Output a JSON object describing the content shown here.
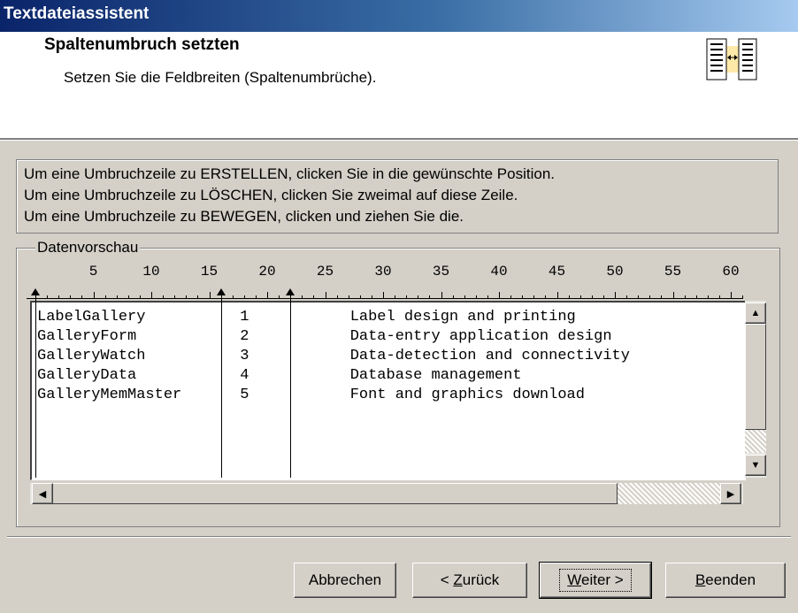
{
  "window": {
    "title": "Textdateiassistent"
  },
  "header": {
    "title": "Spaltenumbruch setzten",
    "subtitle": "Setzen Sie die Feldbreiten (Spaltenumbrüche)."
  },
  "instructions": [
    "Um eine Umbruchzeile zu ERSTELLEN, clicken Sie in die gewünschte Position.",
    "Um eine Umbruchzeile zu LÖSCHEN, clicken Sie zweimal auf diese Zeile.",
    "Um eine Umbruchzeile zu BEWEGEN, clicken und ziehen Sie die."
  ],
  "preview": {
    "label": "Datenvorschau",
    "ruler_numbers": [
      "5",
      "10",
      "15",
      "20",
      "25",
      "30",
      "35",
      "40",
      "45",
      "50",
      "55",
      "60"
    ],
    "column_breaks_at": [
      0,
      16,
      22
    ],
    "rows": [
      [
        "LabelGallery",
        "1",
        "Label design and printing"
      ],
      [
        "GalleryForm",
        "2",
        "Data-entry application design"
      ],
      [
        "GalleryWatch",
        "3",
        "Data-detection and connectivity"
      ],
      [
        "GalleryData",
        "4",
        "Database management"
      ],
      [
        "GalleryMemMaster",
        "5",
        "Font and graphics download"
      ]
    ]
  },
  "buttons": {
    "cancel": "Abbrechen",
    "back_prefix": "< ",
    "back_key": "Z",
    "back_rest": "urück",
    "next_key": "W",
    "next_rest": "eiter >",
    "finish_key": "B",
    "finish_rest": "eenden"
  },
  "icons": {
    "header": "column-break-icon",
    "scroll_up": "up-arrow-icon",
    "scroll_down": "down-arrow-icon",
    "scroll_left": "left-arrow-icon",
    "scroll_right": "right-arrow-icon"
  }
}
